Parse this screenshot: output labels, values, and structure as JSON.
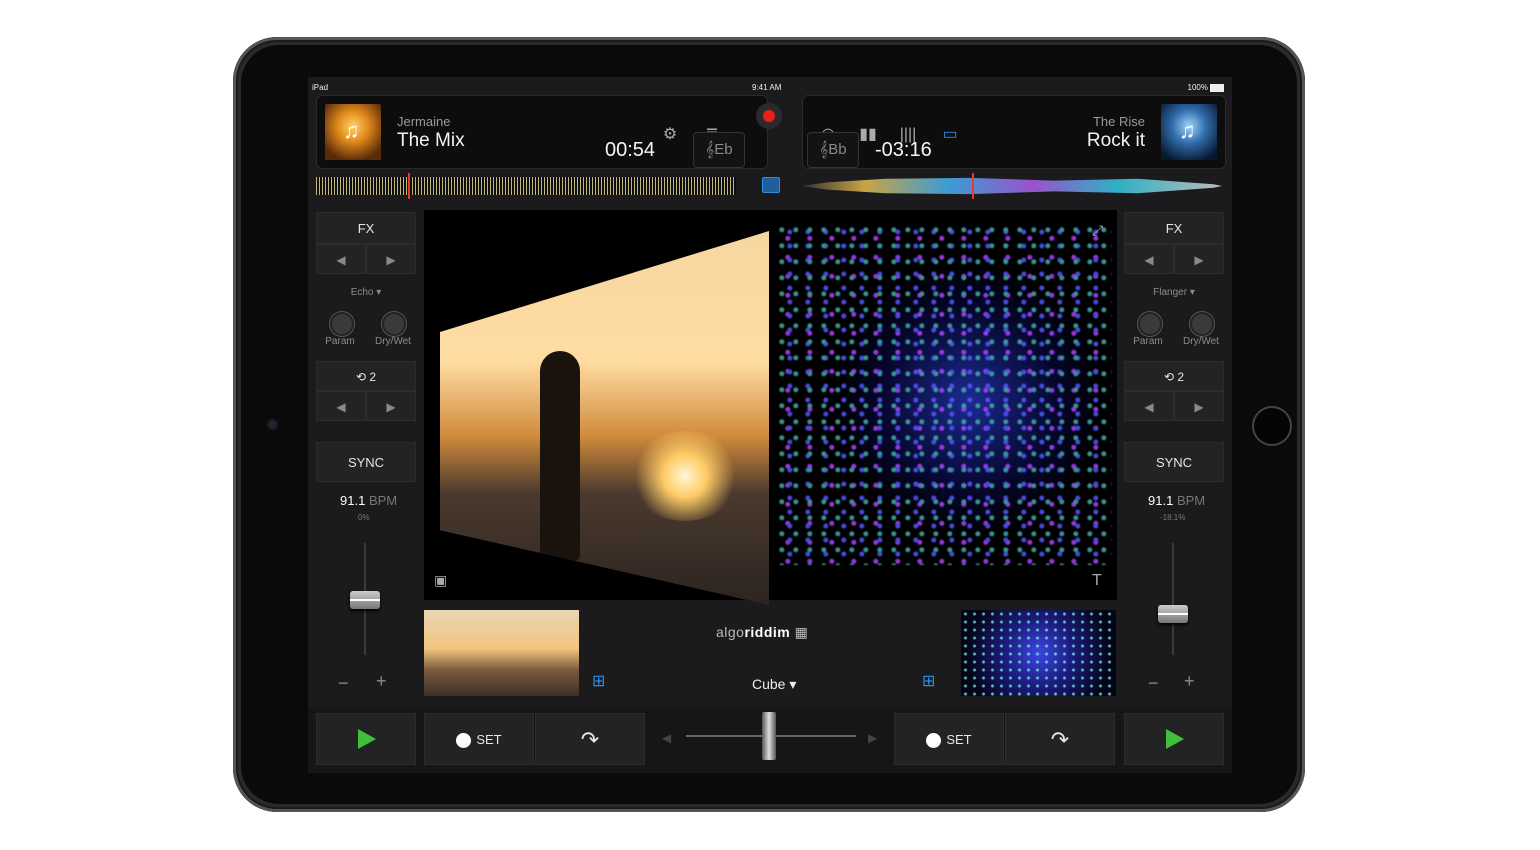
{
  "status": {
    "device": "iPad",
    "time": "9:41 AM",
    "battery": "100%"
  },
  "deck_left": {
    "artist": "Jermaine",
    "title": "The Mix",
    "time": "00:54",
    "key": "Eb",
    "fx_label": "FX",
    "effect": "Echo",
    "param_label": "Param",
    "drywet_label": "Dry/Wet",
    "loop_value": "2",
    "sync_label": "SYNC",
    "bpm": "91.1",
    "bpm_unit": "BPM",
    "pitch": "0%"
  },
  "deck_right": {
    "artist": "The Rise",
    "title": "Rock it",
    "time": "-03:16",
    "key": "Bb",
    "fx_label": "FX",
    "effect": "Flanger",
    "param_label": "Param",
    "drywet_label": "Dry/Wet",
    "loop_value": "2",
    "sync_label": "SYNC",
    "bpm": "91.1",
    "bpm_unit": "BPM",
    "pitch": "-18.1%"
  },
  "center": {
    "logo_light": "algo",
    "logo_bold": "riddim",
    "transition": "Cube"
  },
  "bottom": {
    "set_label": "SET"
  },
  "colors": {
    "record": "#e8221b",
    "play": "#3fbf3a",
    "accent": "#2c8fe5"
  },
  "icons": [
    "music-note-icon",
    "gear-icon",
    "queue-icon",
    "record-icon",
    "turntable-icon",
    "split-icon",
    "sampler-icon",
    "video-icon",
    "expand-icon",
    "image-icon",
    "text-icon",
    "grid-icon",
    "play-icon",
    "rewind-curve-icon",
    "loop-icon"
  ]
}
